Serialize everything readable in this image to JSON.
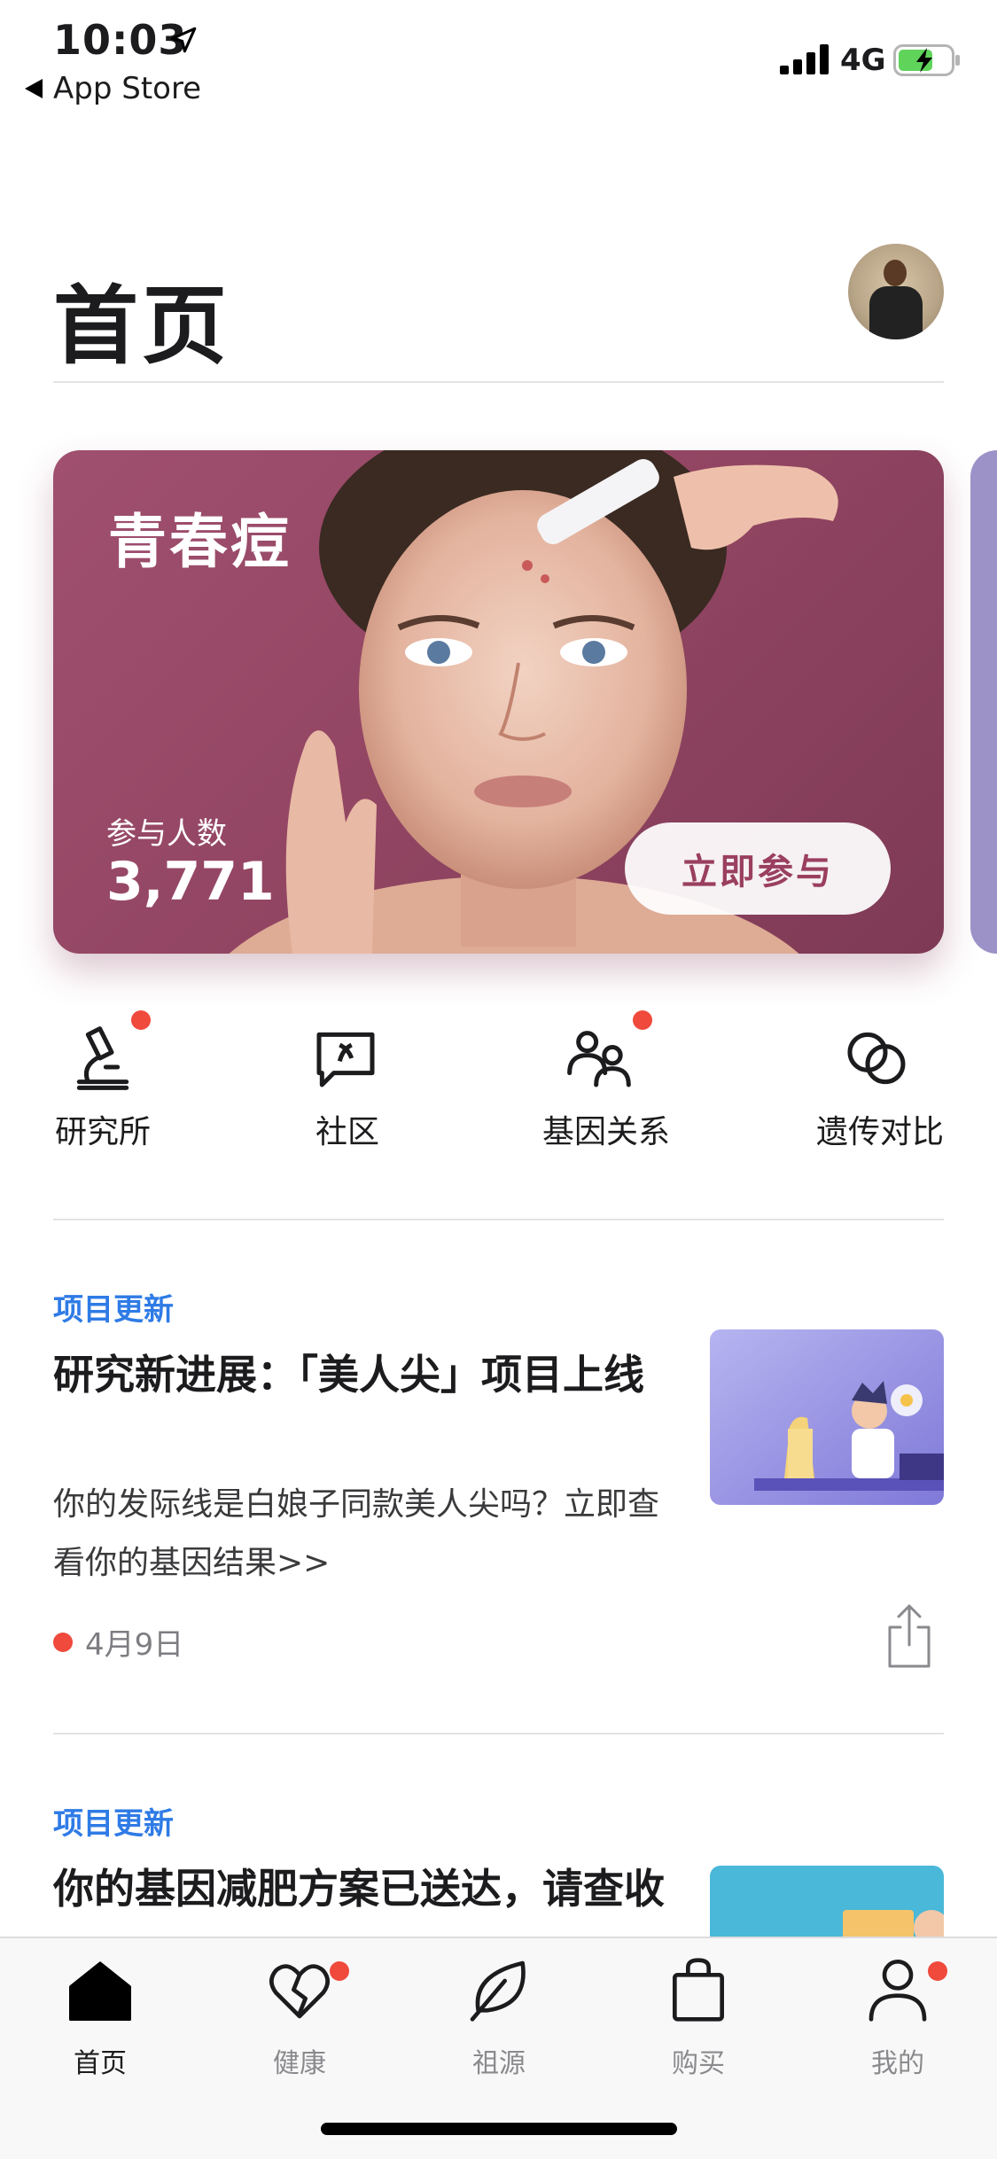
{
  "status_bar": {
    "time": "10:03",
    "back_app": "App Store",
    "network": "4G"
  },
  "header": {
    "title": "首页"
  },
  "hero": {
    "title": "青春痘",
    "participants_label": "参与人数",
    "participants_value": "3,771",
    "button_label": "立即参与"
  },
  "actions": [
    {
      "label": "研究所",
      "icon": "microscope-icon",
      "badge": true
    },
    {
      "label": "社区",
      "icon": "chat-bubble-icon",
      "badge": false
    },
    {
      "label": "基因关系",
      "icon": "people-icon",
      "badge": true
    },
    {
      "label": "遗传对比",
      "icon": "compare-circles-icon",
      "badge": false
    }
  ],
  "articles": [
    {
      "category": "项目更新",
      "title": "研究新进展：「美人尖」项目上线",
      "description": "你的发际线是白娘子同款美人尖吗？立即查看你的基因结果>>",
      "date": "4月9日"
    },
    {
      "category": "项目更新",
      "title": "你的基因减肥方案已送达，请查收"
    }
  ],
  "tabs": [
    {
      "label": "首页",
      "icon": "home-icon",
      "active": true,
      "badge": false
    },
    {
      "label": "健康",
      "icon": "heart-icon",
      "active": false,
      "badge": true
    },
    {
      "label": "祖源",
      "icon": "leaf-icon",
      "active": false,
      "badge": false
    },
    {
      "label": "购买",
      "icon": "shopping-bag-icon",
      "active": false,
      "badge": false
    },
    {
      "label": "我的",
      "icon": "person-icon",
      "active": false,
      "badge": true
    }
  ],
  "colors": {
    "accent_blue": "#2f7be6",
    "badge_red": "#ef4a3c",
    "hero_bg": "#934663",
    "button_text": "#9a3f5f"
  }
}
